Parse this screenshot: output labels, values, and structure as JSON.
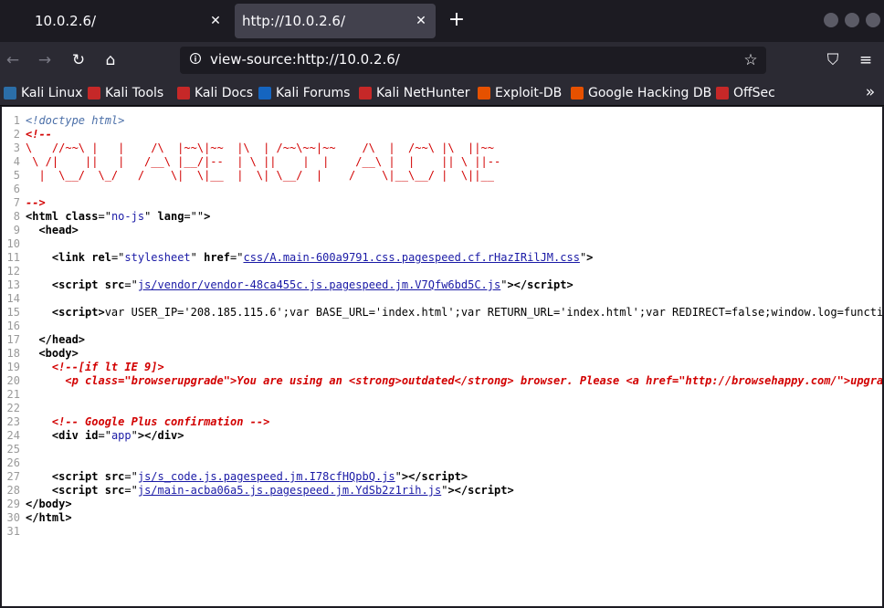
{
  "tabs": [
    {
      "label": "10.0.2.6/"
    },
    {
      "label": "http://10.0.2.6/"
    }
  ],
  "url": "view-source:http://10.0.2.6/",
  "bookmarks": [
    {
      "label": "Kali Linux",
      "color": "#2b6ea8"
    },
    {
      "label": "Kali Tools",
      "color": "#c62828"
    },
    {
      "label": "Kali Docs",
      "color": "#c62828"
    },
    {
      "label": "Kali Forums",
      "color": "#1565c0"
    },
    {
      "label": "Kali NetHunter",
      "color": "#c62828"
    },
    {
      "label": "Exploit-DB",
      "color": "#e65100"
    },
    {
      "label": "Google Hacking DB",
      "color": "#e65100"
    },
    {
      "label": "OffSec",
      "color": "#c62828"
    }
  ],
  "source_lines": [
    {
      "n": "1",
      "html": "<span class='doctype'>&lt;!doctype html&gt;</span>"
    },
    {
      "n": "2",
      "html": "<span class='cmt' style='font-weight:bold'>&lt;!--</span>"
    },
    {
      "n": "3",
      "html": "<span class='art'>\\   //~~\\ |   |    /\\  |~~\\|~~  |\\  | /~~\\~~|~~    /\\  |  /~~\\ |\\  ||~~</span>"
    },
    {
      "n": "4",
      "html": "<span class='art'> \\ /|    ||   |   /__\\ |__/|--  | \\ ||    |  |    /__\\ |  |    || \\ ||--</span>"
    },
    {
      "n": "5",
      "html": "<span class='art'>  |  \\__/  \\_/   /    \\|  \\|__  |  \\| \\__/  |    /    \\|__\\__/ |  \\||__</span>"
    },
    {
      "n": "6",
      "html": "<span class='art'> </span>"
    },
    {
      "n": "7",
      "html": "<span class='cmt' style='font-weight:bold'>--&gt;</span>"
    },
    {
      "n": "8",
      "html": "<span class='tag-plain'>&lt;html</span> <span class='attr'>class</span>=\"<span class='val'>no-js</span>\" <span class='attr'>lang</span>=\"\"<span class='tag-plain'>&gt;</span>"
    },
    {
      "n": "9",
      "html": "  <span class='tag-plain'>&lt;head&gt;</span>"
    },
    {
      "n": "10",
      "html": ""
    },
    {
      "n": "11",
      "html": "    <span class='tag-plain'>&lt;link</span> <span class='attr'>rel</span>=\"<span class='val'>stylesheet</span>\" <span class='attr'>href</span>=\"<span class='link'>css/A.main-600a9791.css.pagespeed.cf.rHazIRilJM.css</span>\"<span class='tag-plain'>&gt;</span>"
    },
    {
      "n": "12",
      "html": ""
    },
    {
      "n": "13",
      "html": "    <span class='tag-plain'>&lt;script</span> <span class='attr'>src</span>=\"<span class='link'>js/vendor/vendor-48ca455c.js.pagespeed.jm.V7Qfw6bd5C.js</span>\"<span class='tag-plain'>&gt;&lt;/script&gt;</span>"
    },
    {
      "n": "14",
      "html": ""
    },
    {
      "n": "15",
      "html": "    <span class='tag-plain'>&lt;script&gt;</span>var USER_IP='208.185.115.6';var BASE_URL='index.html';var RETURN_URL='index.html';var REDIRECT=false;window.log=functi"
    },
    {
      "n": "16",
      "html": ""
    },
    {
      "n": "17",
      "html": "  <span class='tag-plain'>&lt;/head&gt;</span>"
    },
    {
      "n": "18",
      "html": "  <span class='tag-plain'>&lt;body&gt;</span>"
    },
    {
      "n": "19",
      "html": "    <span class='cmt' style='font-weight:bold'>&lt;!--[if lt IE 9]&gt;</span>"
    },
    {
      "n": "20",
      "html": "      <span class='cmt' style='font-weight:bold'>&lt;p class=\"browserupgrade\"&gt;You are using an &lt;strong&gt;outdated&lt;/strong&gt; browser. Please &lt;a href=\"http://browsehappy.com/\"&gt;upgra</span>"
    },
    {
      "n": "21",
      "html": ""
    },
    {
      "n": "22",
      "html": ""
    },
    {
      "n": "23",
      "html": "    <span class='cmt' style='font-weight:bold'>&lt;!-- Google Plus confirmation --&gt;</span>"
    },
    {
      "n": "24",
      "html": "    <span class='tag-plain'>&lt;div</span> <span class='attr'>id</span>=\"<span class='val'>app</span>\"<span class='tag-plain'>&gt;&lt;/div&gt;</span>"
    },
    {
      "n": "25",
      "html": ""
    },
    {
      "n": "26",
      "html": ""
    },
    {
      "n": "27",
      "html": "    <span class='tag-plain'>&lt;script</span> <span class='attr'>src</span>=\"<span class='link'>js/s_code.js.pagespeed.jm.I78cfHQpbQ.js</span>\"<span class='tag-plain'>&gt;&lt;/script&gt;</span>"
    },
    {
      "n": "28",
      "html": "    <span class='tag-plain'>&lt;script</span> <span class='attr'>src</span>=\"<span class='link'>js/main-acba06a5.js.pagespeed.jm.YdSb2z1rih.js</span>\"<span class='tag-plain'>&gt;&lt;/script&gt;</span>"
    },
    {
      "n": "29",
      "html": "<span class='tag-plain'>&lt;/body&gt;</span>"
    },
    {
      "n": "30",
      "html": "<span class='tag-plain'>&lt;/html&gt;</span>"
    },
    {
      "n": "31",
      "html": ""
    }
  ]
}
